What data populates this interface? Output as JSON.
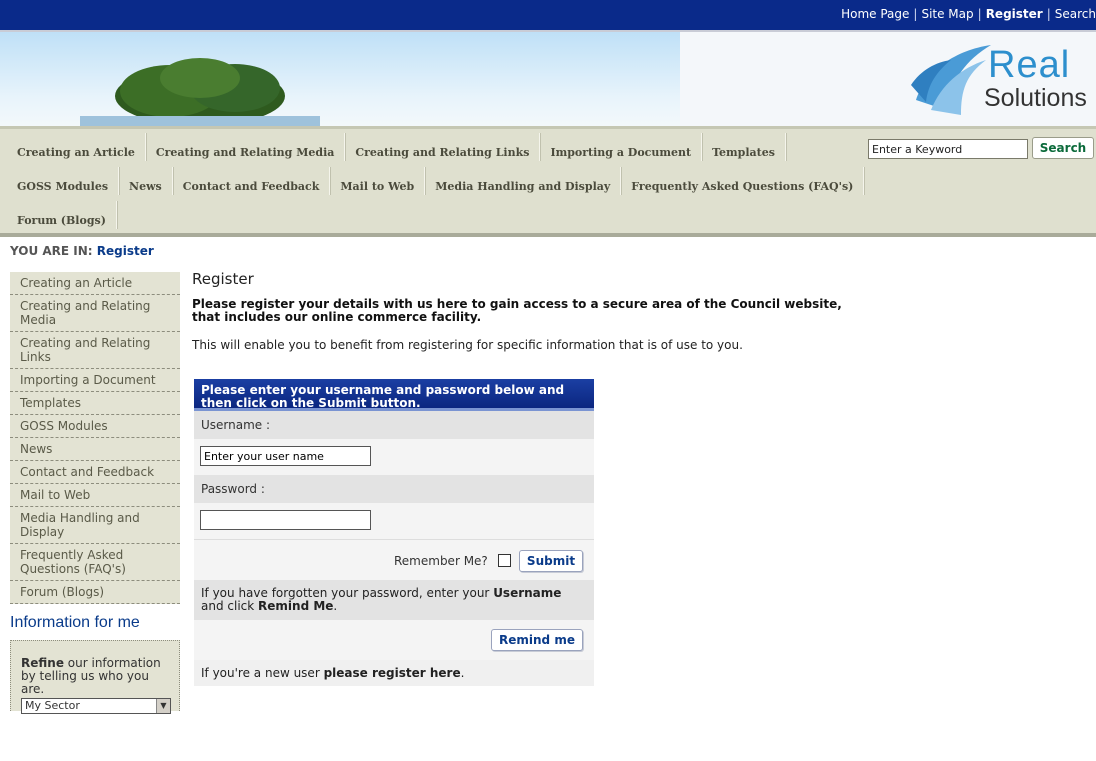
{
  "top_links": {
    "home": "Home Page",
    "sitemap": "Site Map",
    "register": "Register",
    "search": "Search",
    "sep": "|"
  },
  "logo": {
    "line1": "Real",
    "line2": "Solutions"
  },
  "nav": {
    "row1": [
      "Creating an Article",
      "Creating and Relating Media",
      "Creating and Relating Links",
      "Importing a Document",
      "Templates"
    ],
    "row2": [
      "GOSS Modules",
      "News",
      "Contact and Feedback",
      "Mail to Web",
      "Media Handling and Display",
      "Frequently Asked Questions (FAQ's)"
    ],
    "row3": [
      "Forum (Blogs)"
    ],
    "search_value": "Enter a Keyword",
    "search_button": "Search"
  },
  "breadcrumb": {
    "prefix": "YOU ARE IN:",
    "current": "Register"
  },
  "sidebar": {
    "items": [
      "Creating an Article",
      "Creating and Relating Media",
      "Creating and Relating Links",
      "Importing a Document",
      "Templates",
      "GOSS Modules",
      "News",
      "Contact and Feedback",
      "Mail to Web",
      "Media Handling and Display",
      "Frequently Asked Questions (FAQ's)",
      "Forum (Blogs)"
    ],
    "info_heading": "Information for me",
    "refine_bold": "Refine",
    "refine_rest": " our information by telling us who you are.",
    "sector_value": "My Sector"
  },
  "main": {
    "title": "Register",
    "lead": "Please register your details with us here to gain access to a secure area of the Council website, that includes our online commerce facility.",
    "info": "This will enable you to benefit from registering for specific information that is of use to you."
  },
  "form": {
    "header": "Please enter your username and password below and then click on the Submit button.",
    "username_label": "Username :",
    "username_value": "Enter your user name",
    "password_label": "Password :",
    "remember_label": "Remember Me?",
    "submit": "Submit",
    "forgot_part1": "If you have forgotten your password, enter your ",
    "forgot_bold1": "Username",
    "forgot_part2": " and click ",
    "forgot_bold2": "Remind Me",
    "forgot_part3": ".",
    "remind": "Remind me",
    "new_user_prefix": "If you're a new user ",
    "new_user_link": "please register here",
    "new_user_suffix": "."
  }
}
